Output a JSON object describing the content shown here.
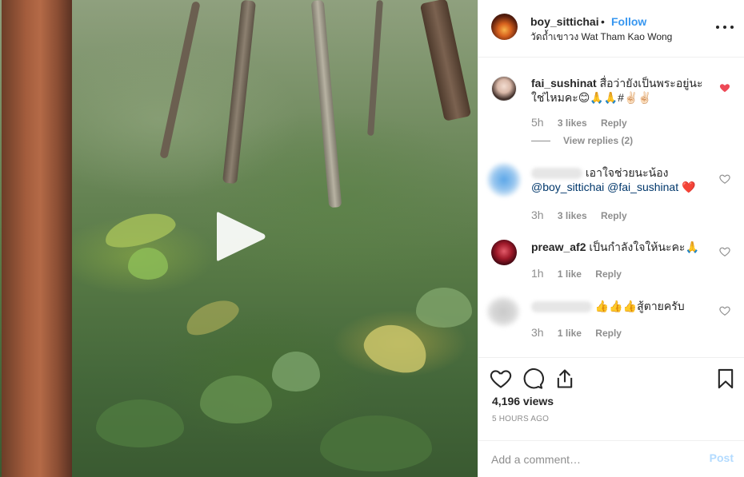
{
  "post": {
    "owner": "boy_sittichai",
    "dot": "•",
    "follow_label": "Follow",
    "location": "วัดถ้ำเขาวง Wat Tham Kao Wong",
    "more_icon": "more-options-icon"
  },
  "media": {
    "type": "video",
    "play_icon": "play-icon"
  },
  "comments": [
    {
      "username": "fai_sushinat",
      "text": "สื่อว่ายังเป็นพระอยู่นะ ใช่ไหมคะ😊🙏🙏#✌🏻✌🏻",
      "time": "5h",
      "likes": "3 likes",
      "reply": "Reply",
      "view_replies": "View replies (2)",
      "liked": true
    },
    {
      "username": "",
      "text": "เอาใจช่วยนะน้อง",
      "mention1": "@boy_sittichai",
      "mention2": "@fai_sushinat",
      "emoji": "❤️",
      "time": "3h",
      "likes": "3 likes",
      "reply": "Reply",
      "liked": false
    },
    {
      "username": "preaw_af2",
      "text": "เป็นกำลังใจให้นะคะ🙏",
      "time": "1h",
      "likes": "1 like",
      "reply": "Reply",
      "liked": false
    },
    {
      "username": "",
      "text": "👍👍👍สู้ตายครับ",
      "time": "3h",
      "likes": "1 like",
      "reply": "Reply",
      "liked": false
    }
  ],
  "actions": {
    "views": "4,196 views",
    "posted_ago": "5 HOURS AGO"
  },
  "comment_box": {
    "placeholder": "Add a comment…",
    "post_label": "Post"
  },
  "colors": {
    "accent": "#3897f0",
    "like_red": "#ed4956",
    "muted": "#8e8e8e",
    "post_disabled": "#b3dbff"
  }
}
